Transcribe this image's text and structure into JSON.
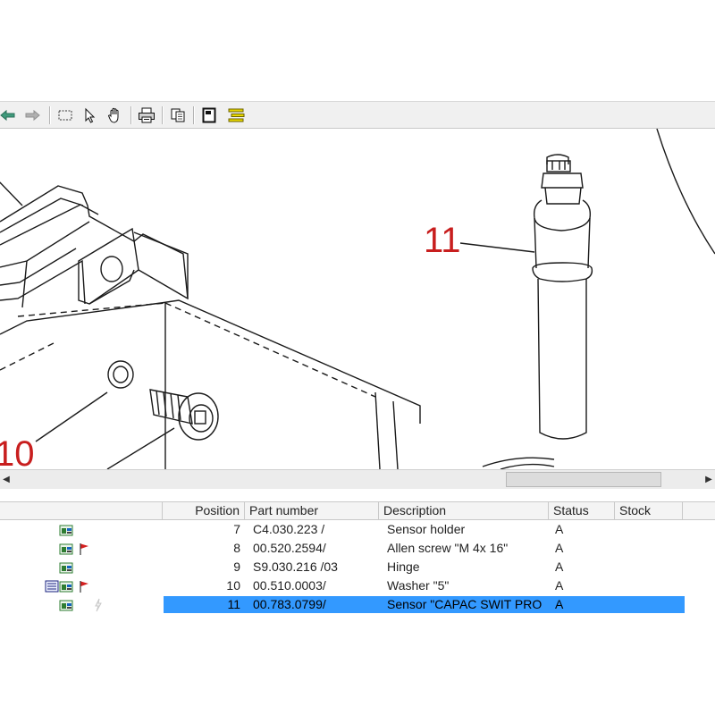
{
  "toolbar": {
    "buttons": [
      {
        "icon": "back-arrow-icon"
      },
      {
        "icon": "forward-arrow-icon"
      },
      {
        "icon": "rectangle-select-icon"
      },
      {
        "icon": "pointer-icon"
      },
      {
        "icon": "hand-pan-icon"
      },
      {
        "icon": "print-icon"
      },
      {
        "icon": "copy-icon"
      },
      {
        "icon": "page-icon"
      },
      {
        "icon": "list-icon"
      }
    ]
  },
  "drawing": {
    "callouts": [
      {
        "label": "11"
      },
      {
        "label": "10"
      }
    ]
  },
  "table": {
    "columns": [
      "Position",
      "Part number",
      "Description",
      "Status",
      "Stock"
    ],
    "rows": [
      {
        "position": "7",
        "part_number": "C4.030.223 /",
        "description": "Sensor holder",
        "status": "A",
        "stock": "",
        "icons": [
          "part-icon"
        ],
        "selected": false
      },
      {
        "position": "8",
        "part_number": "00.520.2594/",
        "description": "Allen screw \"M 4x 16\"",
        "status": "A",
        "stock": "",
        "icons": [
          "part-icon",
          "flag-icon"
        ],
        "selected": false
      },
      {
        "position": "9",
        "part_number": "S9.030.216 /03",
        "description": "Hinge",
        "status": "A",
        "stock": "",
        "icons": [
          "part-icon"
        ],
        "selected": false
      },
      {
        "position": "10",
        "part_number": "00.510.0003/",
        "description": "Washer \"5\"",
        "status": "A",
        "stock": "",
        "icons": [
          "assembly-icon",
          "part-icon",
          "flag-icon"
        ],
        "selected": false
      },
      {
        "position": "11",
        "part_number": "00.783.0799/",
        "description": "Sensor \"CAPAC SWIT PRO",
        "status": "A",
        "stock": "",
        "icons": [
          "part-icon",
          "lightning-icon"
        ],
        "selected": true
      }
    ]
  },
  "colors": {
    "selection": "#3399ff",
    "callout": "#c81e1e",
    "toolbar_bg": "#f0f0f0",
    "flag": "#d42020",
    "icon_green": "#2e7d32"
  }
}
